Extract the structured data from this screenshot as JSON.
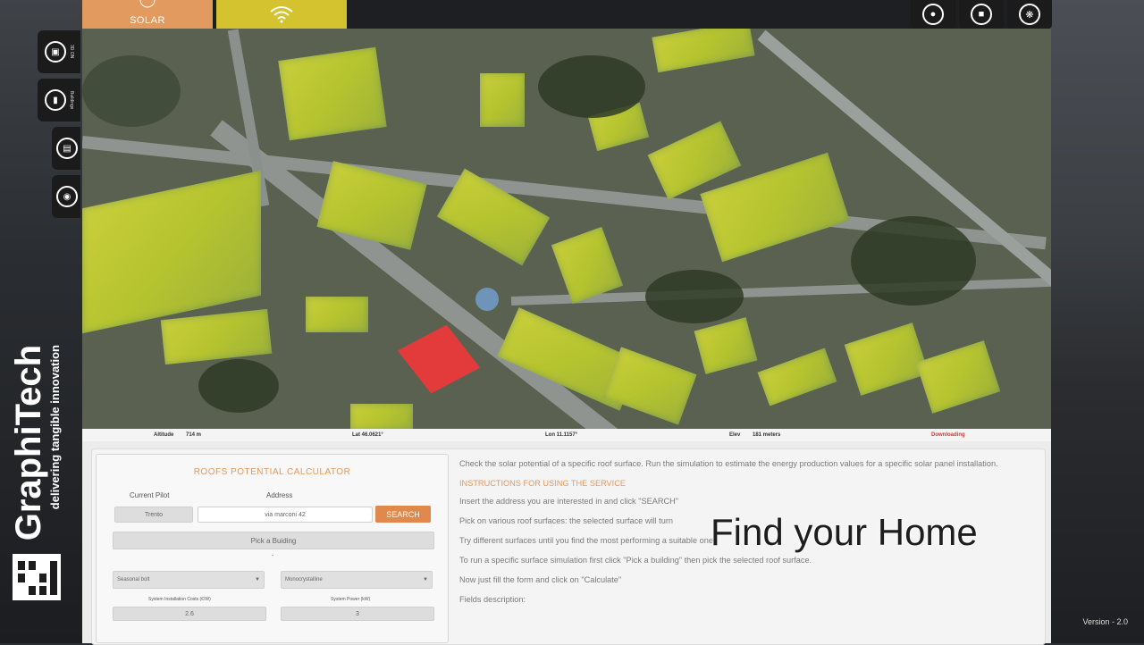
{
  "tabs": {
    "solar": "SOLAR"
  },
  "side_buttons": [
    {
      "label": "3D ON"
    },
    {
      "label": "Buildings"
    }
  ],
  "status_bar": {
    "altitude_label": "Altitude",
    "altitude_value": "714 m",
    "lat": "Lat 46.0621°",
    "lon": "Lon 11.1157°",
    "elev_label": "Elev",
    "elev_value": "181 meters",
    "downloading": "Downloading"
  },
  "calculator": {
    "title": "ROOFS POTENTIAL CALCULATOR",
    "current_pilot_label": "Current Pilot",
    "address_label": "Address",
    "pilot_value": "Trento",
    "address_value": "via marconi 42",
    "search_label": "SEARCH",
    "pick_building_label": "Pick a Buiding",
    "dash": "-",
    "select1": "Seasonal bolt",
    "select2": "Monocrystalline",
    "install_cost_label": "System Installation Costs (€/W)",
    "install_cost_value": "2.6",
    "power_label": "System Power (kW)",
    "power_value": "3"
  },
  "info": {
    "intro": "Check the solar potential of a specific roof surface. Run the simulation to estimate the energy production values for a specific solar panel installation.",
    "instructions_title": "INSTRUCTIONS FOR USING THE SERVICE",
    "lines": [
      "Insert the address you are interested in and click \"SEARCH\"",
      "Pick on various roof surfaces: the selected surface will turn",
      "Try different surfaces until you find the most performing a suitable one.",
      "To run a specific surface simulation first click \"Pick a building\" then pick the selected roof surface.",
      "Now just fill the form and click on \"Calculate\"",
      "Fields description:"
    ]
  },
  "overlay_title": "Find your Home",
  "logo": {
    "brand": "GraphiTech",
    "tagline": "delivering tangible innovation"
  },
  "version": "Version - 2.0",
  "colors": {
    "solar_tab": "#e29a5e",
    "wifi_tab": "#d5c22f",
    "accent": "#e0894c",
    "roof_highlight": "#e33b3b"
  }
}
